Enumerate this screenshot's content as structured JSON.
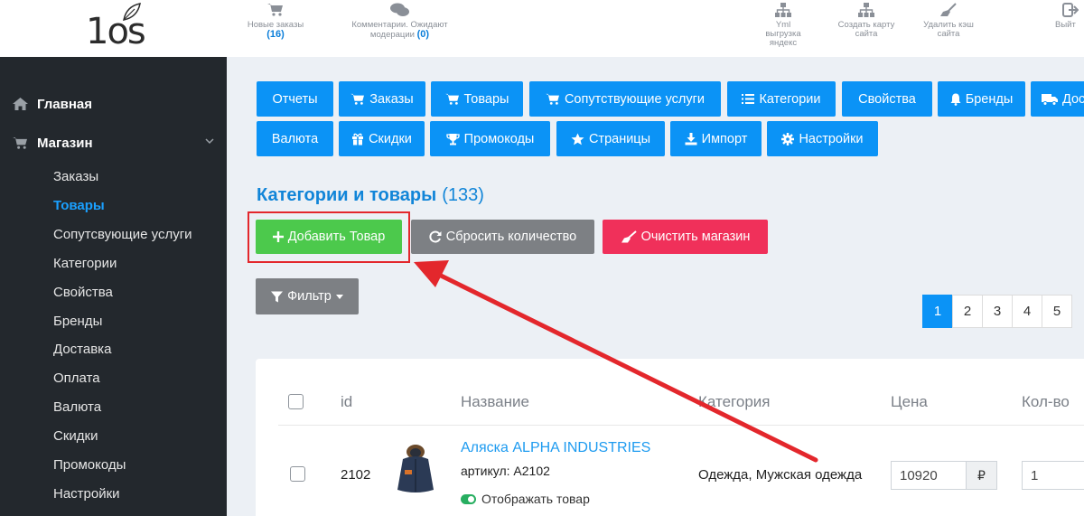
{
  "logo": {
    "text": "1os"
  },
  "header": {
    "items": [
      {
        "icon": "cart-icon",
        "label": "Новые заказы",
        "count": "(16)"
      },
      {
        "icon": "comments-icon",
        "label": "Комментарии. Ожидают модерации",
        "count": "(0)"
      },
      {
        "icon": "sitemap-icon",
        "label": "Yml выгрузка яндекс"
      },
      {
        "icon": "sitemap-icon",
        "label": "Создать карту сайта"
      },
      {
        "icon": "broom-icon",
        "label": "Удалить кэш сайта"
      },
      {
        "icon": "exit-icon",
        "label": "Выйт"
      }
    ]
  },
  "sidebar": {
    "main": [
      {
        "icon": "home-icon",
        "label": "Главная"
      },
      {
        "icon": "cart-icon",
        "label": "Магазин",
        "expanded": true
      }
    ],
    "sub": [
      "Заказы",
      "Товары",
      "Сопутсвующие услуги",
      "Категории",
      "Свойства",
      "Бренды",
      "Доставка",
      "Оплата",
      "Валюта",
      "Скидки",
      "Промокоды",
      "Настройки"
    ],
    "active": "Товары"
  },
  "nav": {
    "row1": [
      "Отчеты",
      "Заказы",
      "Товары",
      "Сопутствующие услуги",
      "Категории",
      "Свойства",
      "Бренды",
      "Дос"
    ],
    "row2": [
      "Валюта",
      "Скидки",
      "Промокоды",
      "Страницы",
      "Импорт",
      "Настройки"
    ]
  },
  "page": {
    "title": "Категории и товары",
    "count": "(133)"
  },
  "actions": {
    "add": "Добавить Товар",
    "reset": "Сбросить количество",
    "clear": "Очистить магазин",
    "filter": "Фильтр"
  },
  "pagination": [
    "1",
    "2",
    "3",
    "4",
    "5"
  ],
  "pagination_active": "1",
  "table": {
    "columns": [
      "id",
      "Название",
      "Категория",
      "Цена",
      "Кол-во"
    ],
    "rows": [
      {
        "id": "2102",
        "name": "Аляска ALPHA INDUSTRIES",
        "sku": "артикул: A2102",
        "visibility": "Отображать товар",
        "category": "Одежда, Мужская одежда",
        "price": "10920",
        "currency": "₽",
        "qty": "1"
      }
    ]
  },
  "colors": {
    "primary": "#0b93f6",
    "success": "#4cc94c",
    "secondary": "#7d8084",
    "danger": "#f0305a",
    "sidebar": "#23282d",
    "annotation": "#e3272c"
  }
}
